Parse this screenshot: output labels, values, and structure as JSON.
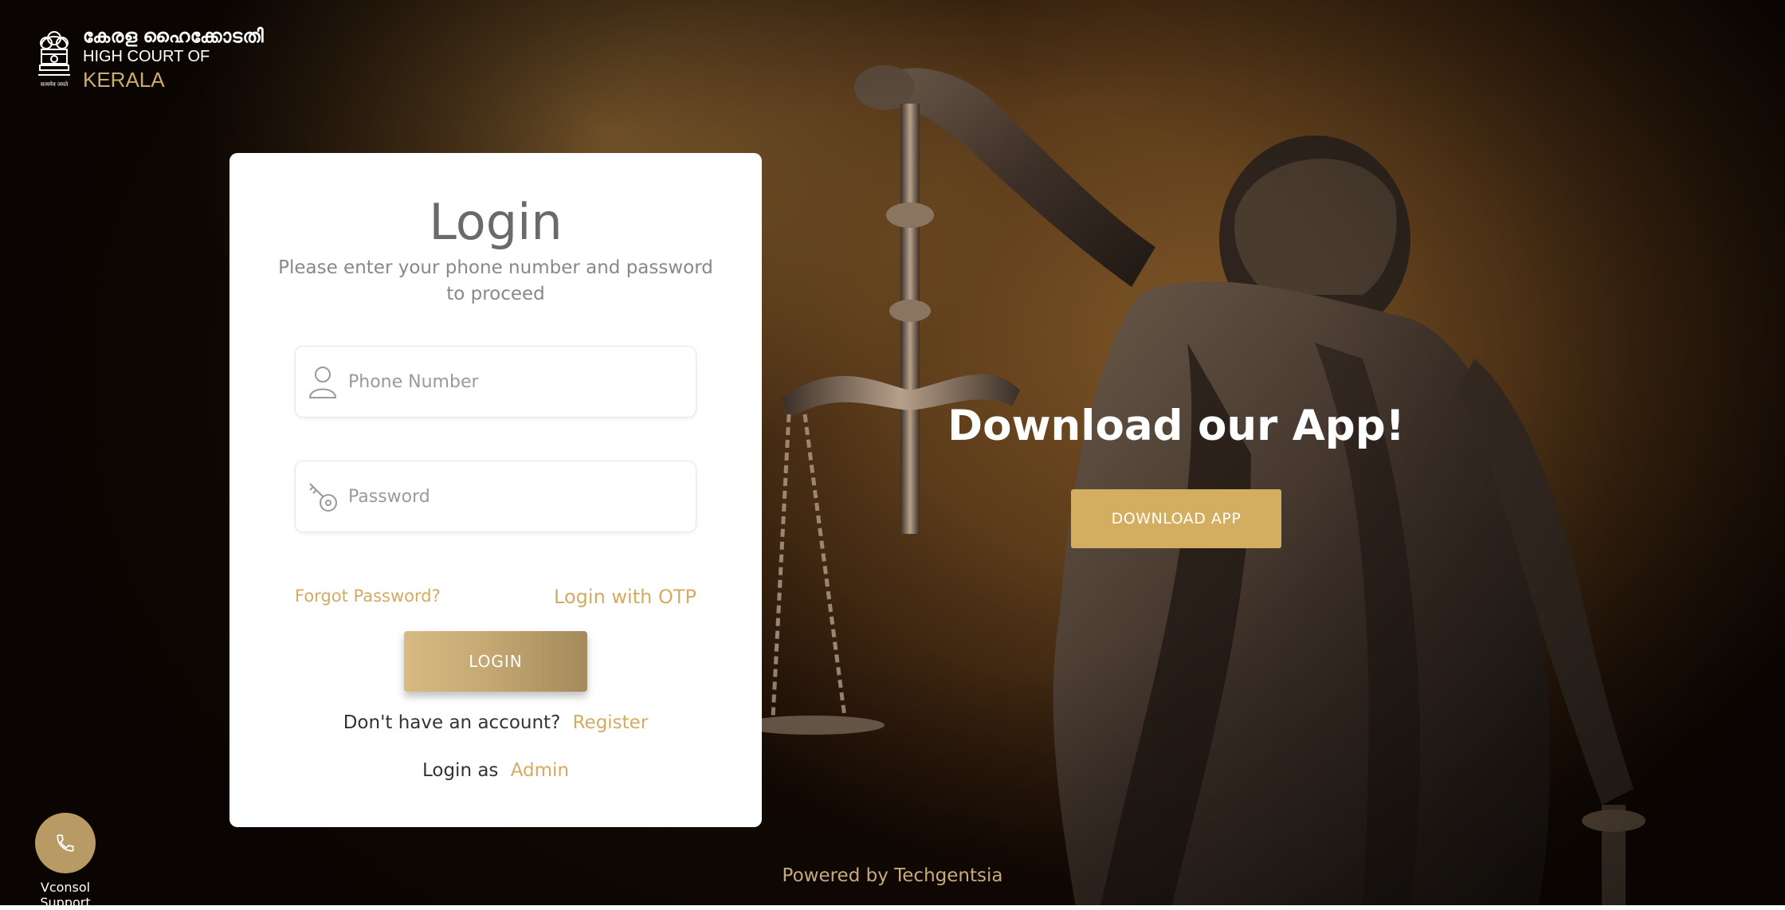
{
  "header": {
    "logo_malayalam": "കേരള ഹൈക്കോടതി",
    "logo_line2": "HIGH COURT OF",
    "logo_line3": "KERALA"
  },
  "login": {
    "title": "Login",
    "subtitle": "Please enter your phone number and password to proceed",
    "phone_placeholder": "Phone Number",
    "password_placeholder": "Password",
    "forgot_label": "Forgot Password?",
    "otp_label": "Login with OTP",
    "login_button": "LOGIN",
    "no_account_text": "Don't have an account?",
    "register_label": "Register",
    "login_as_text": "Login as",
    "admin_label": "Admin"
  },
  "download": {
    "title": "Download our App!",
    "button": "DOWNLOAD APP"
  },
  "footer": {
    "powered_by": "Powered by Techgentsia"
  },
  "support": {
    "label": "Vconsol Support"
  },
  "colors": {
    "accent_gold": "#d4ab62",
    "button_gold": "#d4ae60"
  },
  "icons": [
    "emblem-icon",
    "user-icon",
    "key-icon",
    "phone-icon"
  ]
}
